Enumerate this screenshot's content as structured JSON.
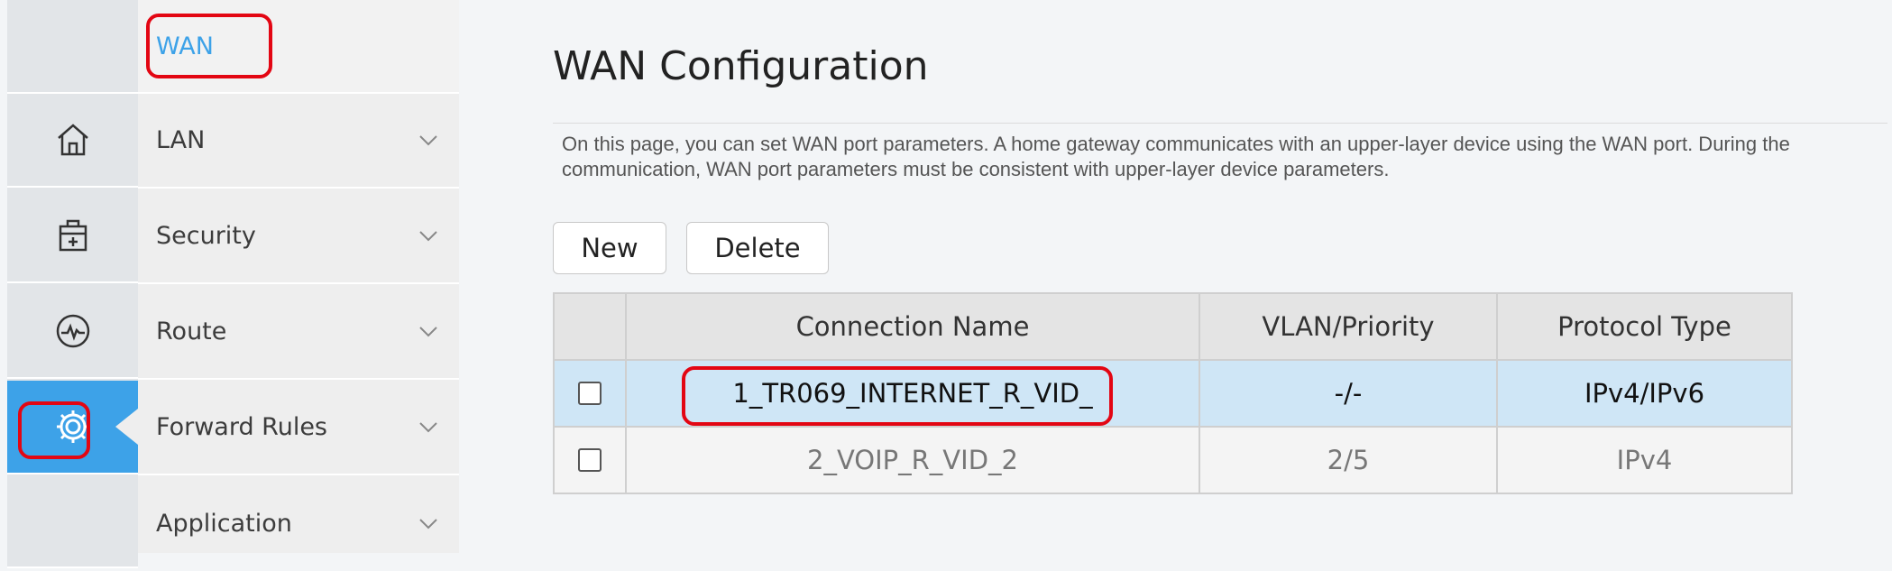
{
  "rail": {
    "icons": [
      "home-icon",
      "toolbox-icon",
      "monitor-heartbeat-icon",
      "gear-icon"
    ],
    "active": "gear-icon",
    "accent": "#3da2e8"
  },
  "menu": {
    "submenu_item": "WAN",
    "items": [
      {
        "label": "LAN"
      },
      {
        "label": "Security"
      },
      {
        "label": "Route"
      },
      {
        "label": "Forward Rules"
      },
      {
        "label": "Application"
      }
    ]
  },
  "main": {
    "title": "WAN Configuration",
    "description": "On this page, you can set WAN port parameters. A home gateway communicates with an upper-layer device using the WAN port. During the communication, WAN port parameters must be consistent with upper-layer device parameters.",
    "buttons": {
      "new": "New",
      "delete": "Delete"
    },
    "table": {
      "headers": [
        "Connection Name",
        "VLAN/Priority",
        "Protocol Type"
      ],
      "rows": [
        {
          "name": "1_TR069_INTERNET_R_VID_",
          "vlan": "-/-",
          "protocol": "IPv4/IPv6",
          "checked": false,
          "selected": true
        },
        {
          "name": "2_VOIP_R_VID_2",
          "vlan": "2/5",
          "protocol": "IPv4",
          "checked": false,
          "selected": false
        }
      ]
    }
  },
  "colors": {
    "highlight": "#e30613",
    "selected_row": "#cfe6f6"
  }
}
